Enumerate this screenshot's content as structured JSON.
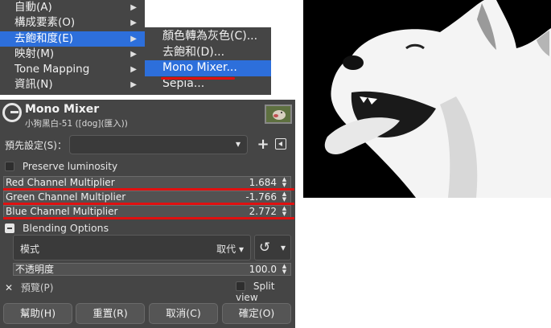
{
  "menu": {
    "items": [
      {
        "label": "自動(A)",
        "has_submenu": true
      },
      {
        "label": "構成要素(O)",
        "has_submenu": true
      },
      {
        "label": "去飽和度(E)",
        "has_submenu": true,
        "active": true
      },
      {
        "label": "映射(M)",
        "has_submenu": true
      },
      {
        "label": "Tone Mapping",
        "has_submenu": true
      },
      {
        "label": "資訊(N)",
        "has_submenu": true
      }
    ],
    "arrow_glyph": "▶"
  },
  "submenu": {
    "items": [
      {
        "label": "顏色轉為灰色(C)..."
      },
      {
        "label": "去飽和(D)..."
      },
      {
        "label": "Mono Mixer...",
        "active": true
      },
      {
        "label": "Sepia..."
      }
    ]
  },
  "dialog": {
    "title": "Mono Mixer",
    "subtitle": "小狗黑白-51 ([dog](匯入))",
    "preset_label": "預先設定(S)：",
    "preset_value": "",
    "preserve_luminosity_label": "Preserve luminosity",
    "preserve_luminosity_checked": false,
    "channels": [
      {
        "label": "Red Channel Multiplier",
        "value": "1.684",
        "highlighted": false
      },
      {
        "label": "Green Channel Multiplier",
        "value": "-1.766",
        "highlighted": true
      },
      {
        "label": "Blue Channel Multiplier",
        "value": "2.772",
        "highlighted": true
      }
    ],
    "blending_label": "Blending Options",
    "mode_label": "模式",
    "mode_value": "取代",
    "opacity_label": "不透明度",
    "opacity_value": "100.0",
    "preview_label": "預覽(P)",
    "preview_checked": true,
    "split_view_label": "Split view",
    "split_view_checked": false,
    "buttons": {
      "help": "幫助(H)",
      "reset": "重置(R)",
      "cancel": "取消(C)",
      "ok": "確定(O)"
    }
  },
  "colors": {
    "accent": "#2d6fdb",
    "highlight_red": "#e01010",
    "panel_bg": "#454545"
  },
  "icons": {
    "gimp": "gimp-logo-icon",
    "chevron": "chevron-down-icon",
    "add": "plus-icon",
    "dock": "dock-arrow-icon",
    "reset_arrow": "reset-curve-icon"
  }
}
